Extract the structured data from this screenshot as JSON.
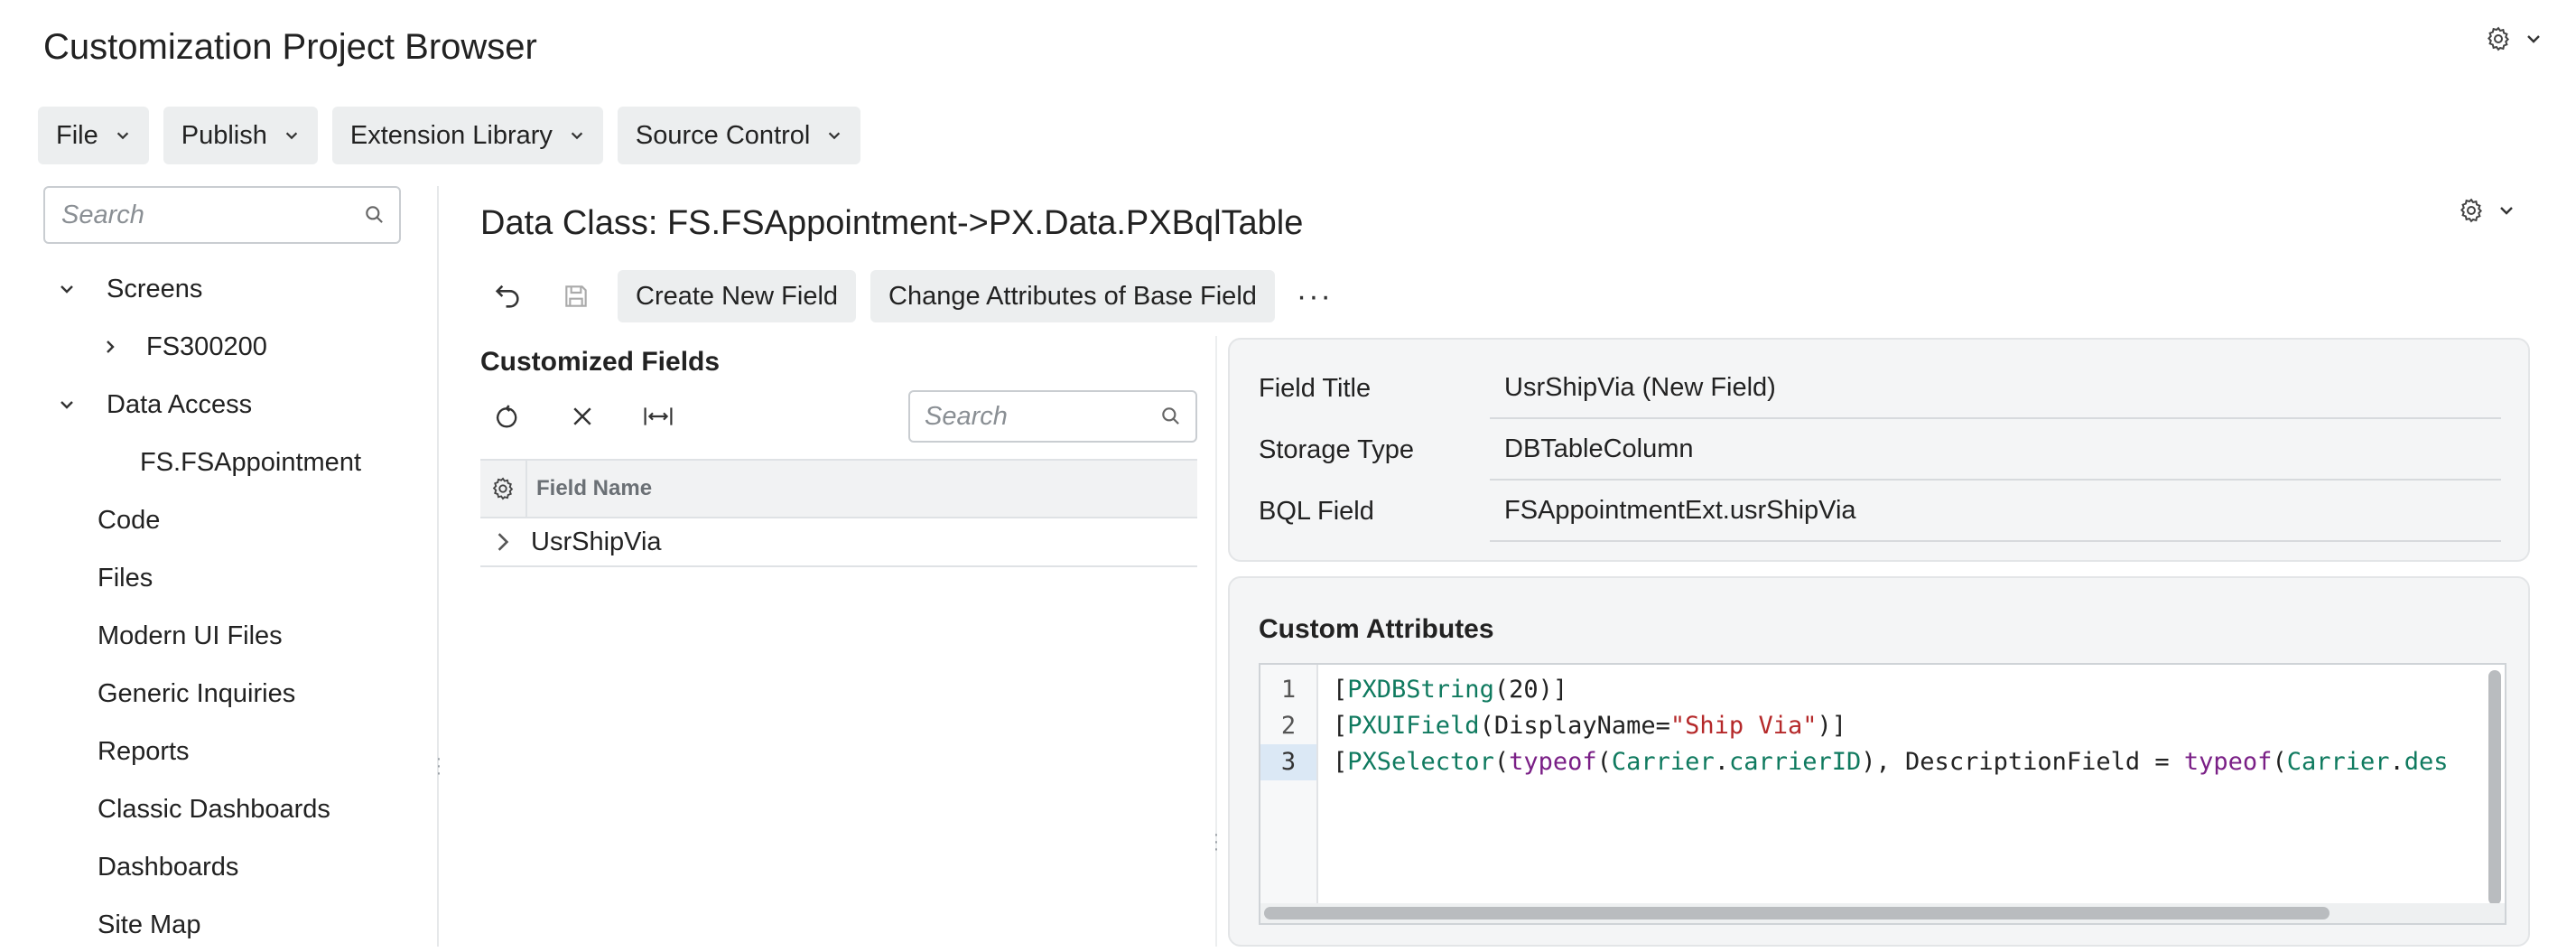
{
  "app": {
    "title": "Customization Project Browser"
  },
  "menubar": {
    "items": [
      {
        "label": "File"
      },
      {
        "label": "Publish"
      },
      {
        "label": "Extension Library"
      },
      {
        "label": "Source Control"
      }
    ]
  },
  "sidebar": {
    "search_placeholder": "Search",
    "tree": [
      {
        "label": "Screens",
        "expanded": true,
        "level": 0
      },
      {
        "label": "FS300200",
        "expanded": false,
        "level": 1
      },
      {
        "label": "Data Access",
        "expanded": true,
        "level": 0
      },
      {
        "label": "FS.FSAppointment",
        "level": 2
      },
      {
        "label": "Code",
        "level": 0
      },
      {
        "label": "Files",
        "level": 0
      },
      {
        "label": "Modern UI Files",
        "level": 0
      },
      {
        "label": "Generic Inquiries",
        "level": 0
      },
      {
        "label": "Reports",
        "level": 0
      },
      {
        "label": "Classic Dashboards",
        "level": 0
      },
      {
        "label": "Dashboards",
        "level": 0
      },
      {
        "label": "Site Map",
        "level": 0
      }
    ]
  },
  "main": {
    "title": "Data Class: FS.FSAppointment->PX.Data.PXBqlTable",
    "toolbar": {
      "create_new_field": "Create New Field",
      "change_attributes": "Change Attributes of Base Field",
      "more": "···"
    },
    "customized_fields": {
      "title": "Customized Fields",
      "search_placeholder": "Search",
      "column_header": "Field Name",
      "rows": [
        {
          "field_name": "UsrShipVia"
        }
      ]
    },
    "properties": {
      "field_title_label": "Field Title",
      "field_title_value": "UsrShipVia (New Field)",
      "storage_type_label": "Storage Type",
      "storage_type_value": "DBTableColumn",
      "bql_field_label": "BQL Field",
      "bql_field_value": "FSAppointmentExt.usrShipVia"
    },
    "custom_attributes": {
      "title": "Custom Attributes",
      "line_numbers": [
        "1",
        "2",
        "3"
      ],
      "active_line": "3",
      "code": [
        "[PXDBString(20)]",
        "[PXUIField(DisplayName=\"Ship Via\")]",
        "[PXSelector(typeof(Carrier.carrierID), DescriptionField = typeof(Carrier.des"
      ]
    }
  },
  "icons": {
    "settings": "gear-icon",
    "dropdown": "chevron-down-icon",
    "undo": "undo-icon",
    "save": "save-icon",
    "refresh": "refresh-icon",
    "delete": "close-icon",
    "fit_columns": "fit-columns-icon",
    "search": "search-icon",
    "expand": "chevron-right-icon"
  },
  "colors": {
    "button_bg": "#eceeef",
    "card_bg": "#f4f5f6",
    "code_attribute": "#0f7a5f",
    "code_keyword": "#7a1f86",
    "code_string": "#b5292a",
    "active_line_bg": "#dbe8f5"
  }
}
